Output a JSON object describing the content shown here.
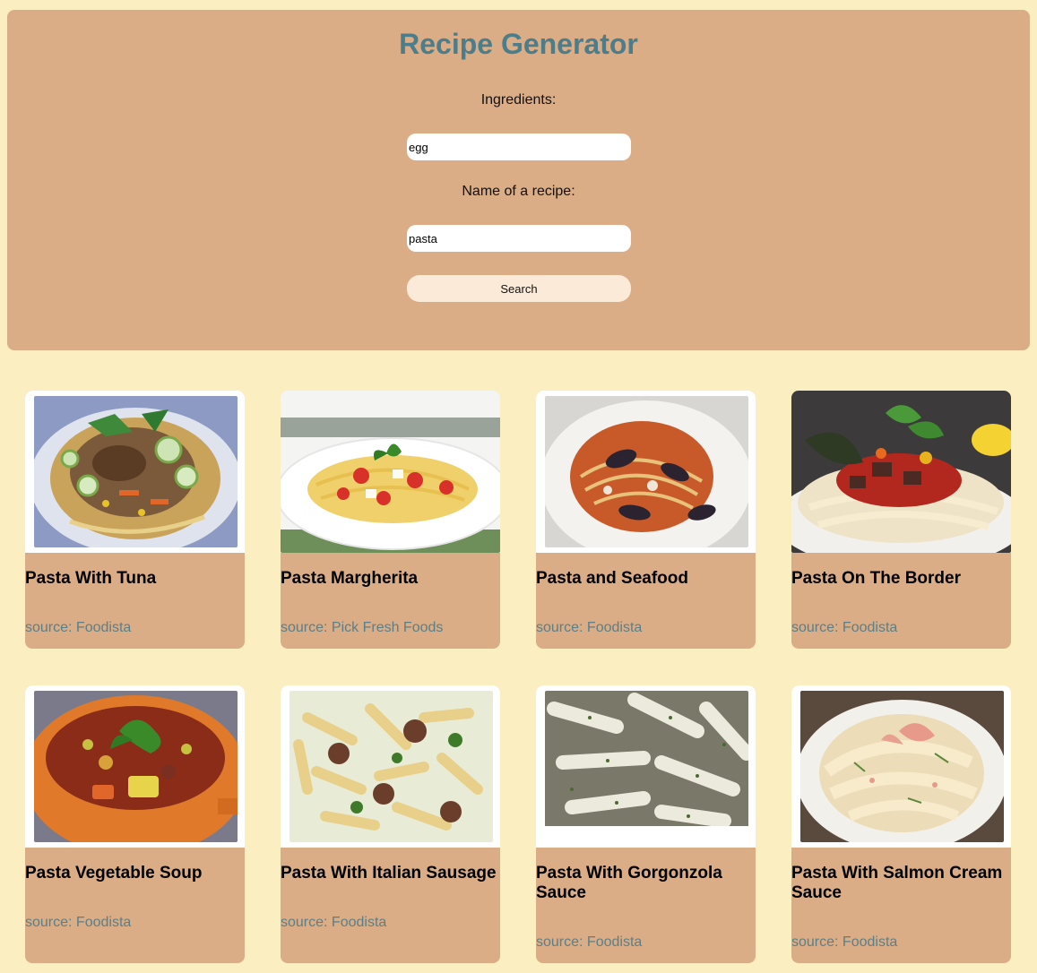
{
  "header": {
    "title": "Recipe Generator",
    "ingredients_label": "Ingredients:",
    "ingredients_value": "egg",
    "recipe_label": "Name of a recipe:",
    "recipe_value": "pasta",
    "search_label": "Search"
  },
  "colors": {
    "page_background": "#fbeec1",
    "panel": "#daad86",
    "title": "#4c7d8a",
    "source_text": "#5b7f88",
    "button": "#fbead8"
  },
  "recipes": [
    {
      "title": "Pasta With Tuna",
      "source": "source: Foodista",
      "image": "tuna-pasta-bowl"
    },
    {
      "title": "Pasta Margherita",
      "source": "source: Pick Fresh Foods",
      "image": "spaghetti-tomato-basil"
    },
    {
      "title": "Pasta and Seafood",
      "source": "source: Foodista",
      "image": "spaghetti-mussels"
    },
    {
      "title": "Pasta On The Border",
      "source": "source: Foodista",
      "image": "fettuccine-beef-peppers"
    },
    {
      "title": "Pasta Vegetable Soup",
      "source": "source: Foodista",
      "image": "vegetable-soup-bowl"
    },
    {
      "title": "Pasta With Italian Sausage",
      "source": "source: Foodista",
      "image": "penne-sausage"
    },
    {
      "title": "Pasta With Gorgonzola Sauce",
      "source": "source: Foodista",
      "image": "penne-cream-sauce"
    },
    {
      "title": "Pasta With Salmon Cream Sauce",
      "source": "source: Foodista",
      "image": "pappardelle-salmon"
    }
  ]
}
